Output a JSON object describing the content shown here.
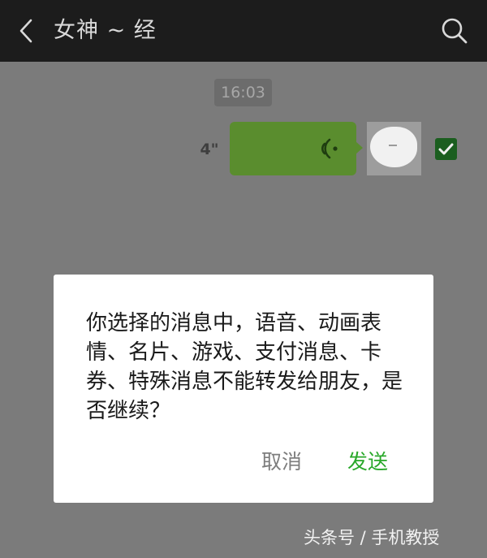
{
  "header": {
    "title": "女神 ~ 经",
    "back_icon": "chevron-left-icon",
    "search_icon": "search-icon"
  },
  "chat": {
    "timestamp": "16:03",
    "messages": [
      {
        "type": "voice",
        "direction": "outgoing",
        "duration": "4\"",
        "icon": "voice-wave-icon",
        "selected": true
      }
    ]
  },
  "dialog": {
    "message": "你选择的消息中，语音、动画表情、名片、游戏、支付消息、卡券、特殊消息不能转发给朋友，是否继续？",
    "cancel_label": "取消",
    "confirm_label": "发送"
  },
  "watermark": "头条号 / 手机教授",
  "colors": {
    "topbar": "#1c1c1c",
    "overlay_background": "#7b7b7b",
    "bubble": "#5a8d2e",
    "checkbox": "#1b5e1f",
    "confirm": "#29a82a",
    "cancel": "#7d7d7d"
  }
}
